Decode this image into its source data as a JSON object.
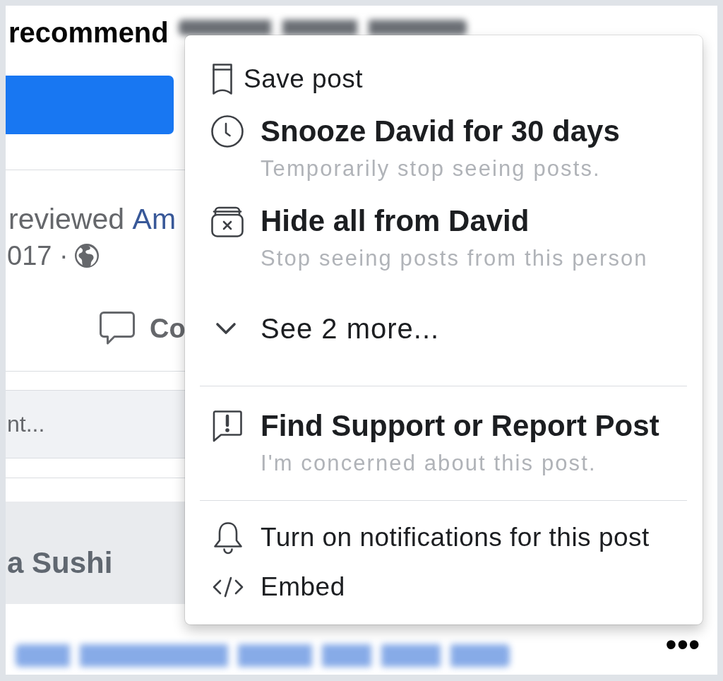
{
  "post": {
    "heading": "recommend",
    "activity": {
      "text": "reviewed",
      "link": "Am"
    },
    "date": "017 ·",
    "comment_action": "Co",
    "comment_field": {
      "placeholder": "nt..."
    },
    "link_preview": {
      "title": "a Sushi"
    },
    "more_button": "•••"
  },
  "menu": {
    "items": [
      {
        "kind": "action",
        "label": "Save post"
      },
      {
        "kind": "detailed",
        "label": "Snooze David for 30 days",
        "description": "Temporarily stop seeing posts."
      },
      {
        "kind": "detailed",
        "label": "Hide all from David",
        "description": "Stop seeing posts from this person"
      },
      {
        "kind": "expand",
        "label": "See 2 more...",
        "expanded": false
      },
      {
        "kind": "divider"
      },
      {
        "kind": "detailed",
        "label": "Find Support or Report Post",
        "description": "I'm concerned about this post."
      },
      {
        "kind": "divider"
      },
      {
        "kind": "action",
        "label": "Turn on notifications for this post"
      },
      {
        "kind": "action",
        "label": "Embed"
      }
    ]
  }
}
